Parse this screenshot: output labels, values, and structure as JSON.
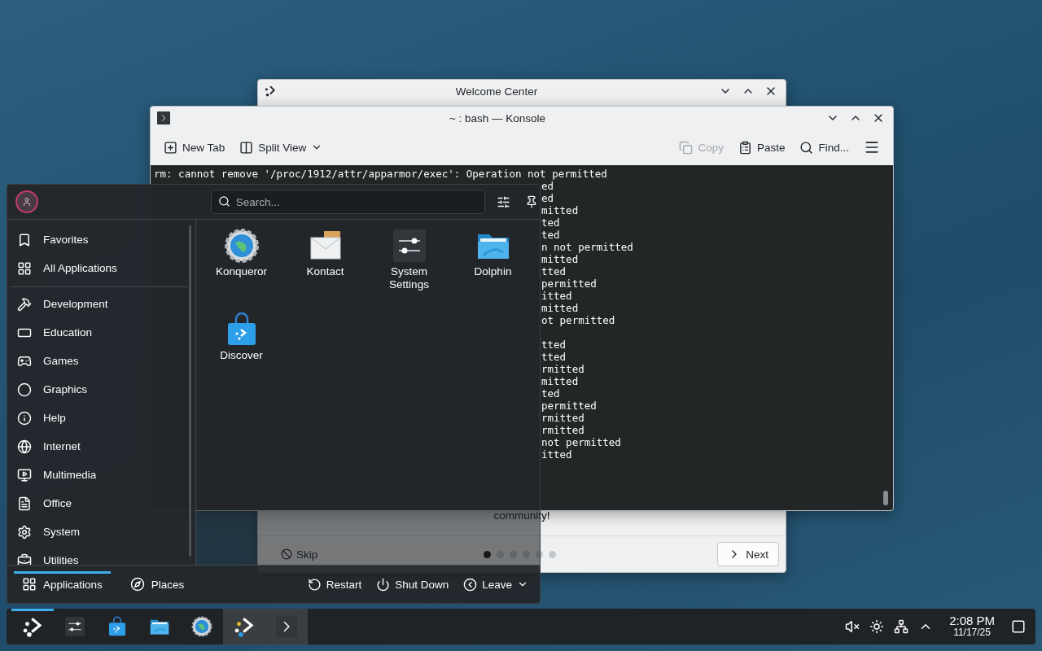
{
  "welcome_center": {
    "title": "Welcome Center",
    "body_text": "community!",
    "skip": "Skip",
    "pages": [
      {
        "selected": true
      },
      {
        "selected": false
      },
      {
        "selected": false
      },
      {
        "selected": false
      },
      {
        "selected": false
      },
      {
        "selected": false
      }
    ],
    "next": "Next"
  },
  "konsole": {
    "title": "~ : bash — Konsole",
    "toolbar": [
      {
        "label": "New Tab",
        "kind": "newtab",
        "disabled": false
      },
      {
        "label": "Split View",
        "kind": "split",
        "disabled": false
      },
      {
        "label": "Copy",
        "kind": "copy",
        "disabled": true
      },
      {
        "label": "Paste",
        "kind": "paste",
        "disabled": false
      },
      {
        "label": "Find...",
        "kind": "find",
        "disabled": false
      }
    ],
    "first_line": "rm: cannot remove '/proc/1912/attr/apparmor/exec': Operation not permitted",
    "visible_line_ends": [
      {
        "text": "ed",
        "blank_before": false
      },
      {
        "text": "ed",
        "blank_before": false
      },
      {
        "text": "mitted",
        "blank_before": false
      },
      {
        "text": "ted",
        "blank_before": false
      },
      {
        "text": "ted",
        "blank_before": false
      },
      {
        "text": "n not permitted",
        "blank_before": false
      },
      {
        "text": "mitted",
        "blank_before": false
      },
      {
        "text": "tted",
        "blank_before": false
      },
      {
        "text": "permitted",
        "blank_before": false
      },
      {
        "text": "itted",
        "blank_before": false
      },
      {
        "text": "mitted",
        "blank_before": false
      },
      {
        "text": "ot permitted",
        "blank_before": false
      },
      {
        "text": "tted",
        "blank_before": true
      },
      {
        "text": "tted",
        "blank_before": false
      },
      {
        "text": "rmitted",
        "blank_before": false
      },
      {
        "text": "mitted",
        "blank_before": false
      },
      {
        "text": "ted",
        "blank_before": false
      },
      {
        "text": "permitted",
        "blank_before": false
      },
      {
        "text": "rmitted",
        "blank_before": false
      },
      {
        "text": "rmitted",
        "blank_before": false
      },
      {
        "text": "not permitted",
        "blank_before": false
      },
      {
        "text": "itted",
        "blank_before": false
      }
    ]
  },
  "launcher": {
    "search": {
      "placeholder": "Search..."
    },
    "sidebar": [
      {
        "label": "Favorites"
      },
      {
        "label": "All Applications"
      }
    ],
    "categories": [
      {
        "label": "Development"
      },
      {
        "label": "Education"
      },
      {
        "label": "Games"
      },
      {
        "label": "Graphics"
      },
      {
        "label": "Help"
      },
      {
        "label": "Internet"
      },
      {
        "label": "Multimedia"
      },
      {
        "label": "Office"
      },
      {
        "label": "System"
      },
      {
        "label": "Utilities"
      }
    ],
    "apps": [
      {
        "name": "Konqueror",
        "kind": "browser"
      },
      {
        "name": "Kontact",
        "kind": "mail"
      },
      {
        "name": "System Settings",
        "kind": "settings"
      },
      {
        "name": "Dolphin",
        "kind": "files"
      },
      {
        "name": "Discover",
        "kind": "store"
      }
    ],
    "footer_tabs": [
      {
        "label": "Applications",
        "selected": true
      },
      {
        "label": "Places",
        "selected": false
      }
    ],
    "power": [
      {
        "label": "Restart",
        "kind": "restart"
      },
      {
        "label": "Shut Down",
        "kind": "shutdown"
      },
      {
        "label": "Leave",
        "kind": "leave"
      }
    ]
  },
  "taskbar": {
    "items": [
      {
        "kind": "launcher",
        "active": true,
        "open": false
      },
      {
        "kind": "settings",
        "active": false,
        "open": false
      },
      {
        "kind": "store",
        "active": false,
        "open": false
      },
      {
        "kind": "files",
        "active": false,
        "open": false
      },
      {
        "kind": "browser",
        "active": false,
        "open": false
      },
      {
        "kind": "welcome",
        "active": false,
        "open": true
      },
      {
        "kind": "terminal",
        "active": false,
        "open": true
      }
    ],
    "time": "2:08 PM",
    "date": "11/17/25"
  }
}
